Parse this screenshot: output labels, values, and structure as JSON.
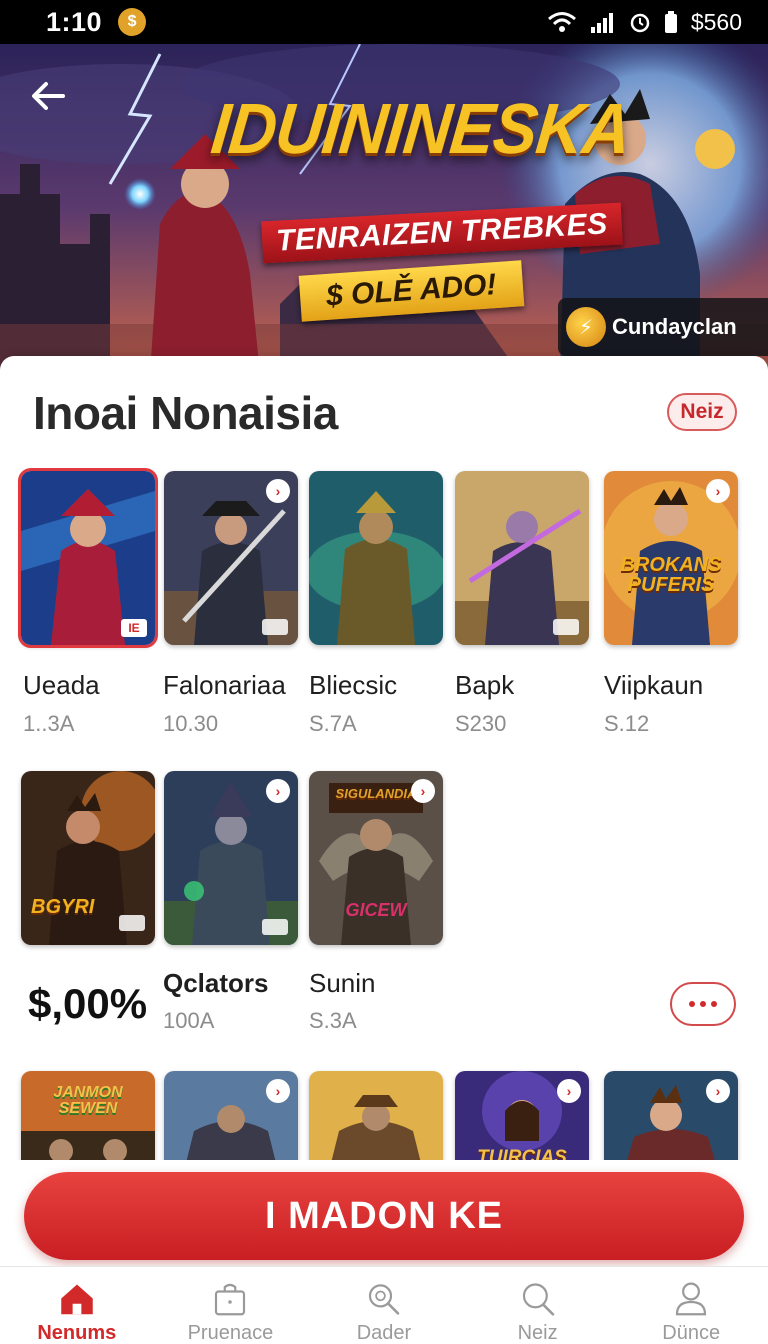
{
  "status_bar": {
    "time": "1:10",
    "coin_icon": "coin-icon",
    "right_text": "$560",
    "icons": [
      "wifi-icon",
      "signal-icon",
      "alarm-icon",
      "battery-icon"
    ]
  },
  "hero": {
    "title": "IDUININESKA",
    "subtitle": "TENRAIZEN TREBKES",
    "tag": "$ OLĚ ADO!",
    "brand": "Cundayclan",
    "back_icon": "back-arrow-icon"
  },
  "section": {
    "title": "Inoai Nonaisia",
    "badge": "Neiz"
  },
  "games_row1": [
    {
      "name": "Ueada",
      "price": "1..3A"
    },
    {
      "name": "Falonariaa",
      "price": "10.30"
    },
    {
      "name": "Bliecsic",
      "price": "S.7A"
    },
    {
      "name": "Bapk",
      "price": "S230"
    },
    {
      "name": "Viipkaun",
      "price": "S.12"
    }
  ],
  "card_art_text": {
    "r1c5": "BROKANS PUFERIS",
    "r2c1": "BGYRI",
    "r2c3_top": "SIGULANDIA",
    "r2c3_bottom": "GICEW",
    "r3c1": "JANMON SEWEN",
    "r3c4": "TUIRCIAS",
    "r1c1_corner": "IE"
  },
  "games_row2": [
    {
      "name": "Qclators",
      "price": "100A"
    },
    {
      "name": "Sunin",
      "price": "S.3A"
    }
  ],
  "price_big": "$,00%",
  "cta_label": "I MADON KE",
  "bottom_nav": [
    {
      "label": "Nenums",
      "icon": "home-icon",
      "active": true
    },
    {
      "label": "Pruenace",
      "icon": "bag-icon",
      "active": false
    },
    {
      "label": "Dader",
      "icon": "search-alt-icon",
      "active": false
    },
    {
      "label": "Neiz",
      "icon": "search-icon",
      "active": false
    },
    {
      "label": "Dünce",
      "icon": "profile-icon",
      "active": false
    }
  ],
  "colors": {
    "accent": "#d22a2a",
    "title_gold": "#f6c224",
    "price_gray": "#8c8c8c"
  }
}
